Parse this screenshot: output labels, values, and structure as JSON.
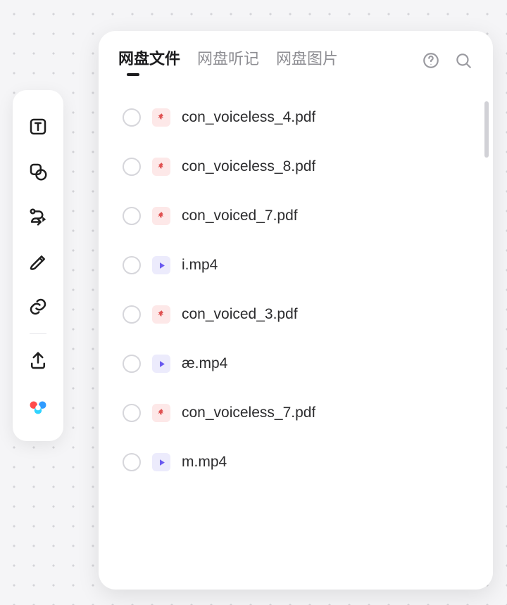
{
  "tabs": [
    {
      "label": "网盘文件",
      "active": true
    },
    {
      "label": "网盘听记",
      "active": false
    },
    {
      "label": "网盘图片",
      "active": false
    }
  ],
  "toolbar": {
    "items": [
      {
        "name": "text-box-icon"
      },
      {
        "name": "shape-icon"
      },
      {
        "name": "connector-icon"
      },
      {
        "name": "pen-icon"
      },
      {
        "name": "link-icon"
      }
    ],
    "export_name": "export-icon",
    "cloud_name": "baidu-cloud-icon"
  },
  "files": [
    {
      "name": "con_voiceless_4.pdf",
      "type": "pdf"
    },
    {
      "name": "con_voiceless_8.pdf",
      "type": "pdf"
    },
    {
      "name": "con_voiced_7.pdf",
      "type": "pdf"
    },
    {
      "name": "i.mp4",
      "type": "mp4"
    },
    {
      "name": "con_voiced_3.pdf",
      "type": "pdf"
    },
    {
      "name": "æ.mp4",
      "type": "mp4"
    },
    {
      "name": "con_voiceless_7.pdf",
      "type": "pdf"
    },
    {
      "name": "m.mp4",
      "type": "mp4"
    }
  ]
}
